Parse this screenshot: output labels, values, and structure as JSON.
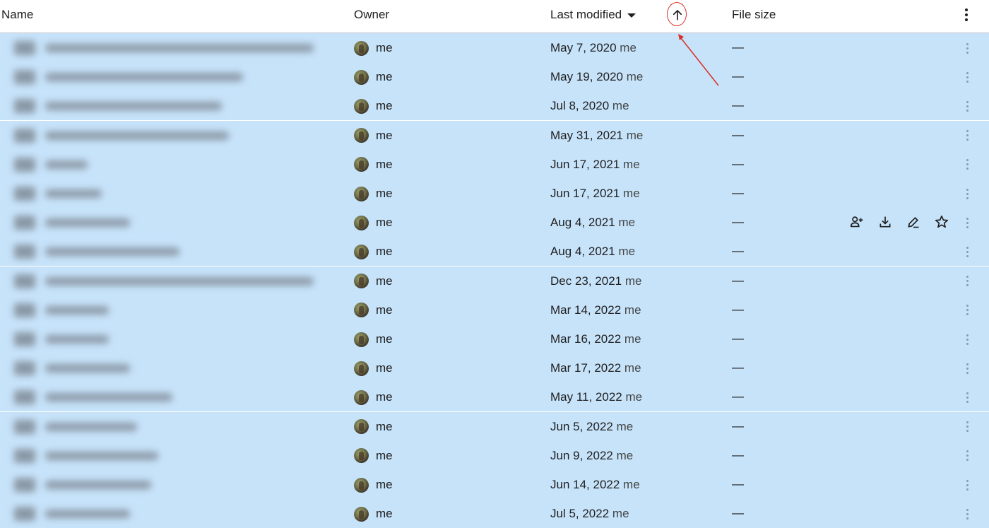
{
  "header": {
    "name": "Name",
    "owner": "Owner",
    "last_modified": "Last modified",
    "file_size": "File size"
  },
  "icons": {
    "sort_direction": "arrow-up-icon",
    "header_more": "more-vertical-icon",
    "share": "person-add-icon",
    "download": "download-icon",
    "rename": "edit-icon",
    "star": "star-icon"
  },
  "colors": {
    "selected_row": "#c7e3fa",
    "annotation": "#d93025"
  },
  "rows": [
    {
      "owner": "me",
      "date": "May 7, 2020",
      "modified_by": "me",
      "size": "—"
    },
    {
      "owner": "me",
      "date": "May 19, 2020",
      "modified_by": "me",
      "size": "—"
    },
    {
      "owner": "me",
      "date": "Jul 8, 2020",
      "modified_by": "me",
      "size": "—"
    },
    {
      "owner": "me",
      "date": "May 31, 2021",
      "modified_by": "me",
      "size": "—"
    },
    {
      "owner": "me",
      "date": "Jun 17, 2021",
      "modified_by": "me",
      "size": "—"
    },
    {
      "owner": "me",
      "date": "Jun 17, 2021",
      "modified_by": "me",
      "size": "—"
    },
    {
      "owner": "me",
      "date": "Aug 4, 2021",
      "modified_by": "me",
      "size": "—"
    },
    {
      "owner": "me",
      "date": "Aug 4, 2021",
      "modified_by": "me",
      "size": "—"
    },
    {
      "owner": "me",
      "date": "Dec 23, 2021",
      "modified_by": "me",
      "size": "—"
    },
    {
      "owner": "me",
      "date": "Mar 14, 2022",
      "modified_by": "me",
      "size": "—"
    },
    {
      "owner": "me",
      "date": "Mar 16, 2022",
      "modified_by": "me",
      "size": "—"
    },
    {
      "owner": "me",
      "date": "Mar 17, 2022",
      "modified_by": "me",
      "size": "—"
    },
    {
      "owner": "me",
      "date": "May 11, 2022",
      "modified_by": "me",
      "size": "—"
    },
    {
      "owner": "me",
      "date": "Jun 5, 2022",
      "modified_by": "me",
      "size": "—"
    },
    {
      "owner": "me",
      "date": "Jun 9, 2022",
      "modified_by": "me",
      "size": "—"
    },
    {
      "owner": "me",
      "date": "Jun 14, 2022",
      "modified_by": "me",
      "size": "—"
    },
    {
      "owner": "me",
      "date": "Jul 5, 2022",
      "modified_by": "me",
      "size": "—"
    }
  ]
}
